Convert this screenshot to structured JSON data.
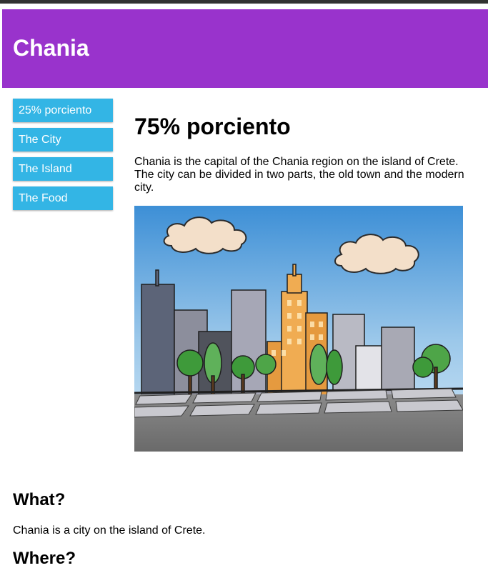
{
  "header": {
    "title": "Chania"
  },
  "menu": {
    "items": [
      {
        "label": "25% porciento"
      },
      {
        "label": "The City"
      },
      {
        "label": "The Island"
      },
      {
        "label": "The Food"
      }
    ]
  },
  "main": {
    "heading": "75% porciento",
    "paragraph": "Chania is the capital of the Chania region on the island of Crete. The city can be divided in two parts, the old town and the modern city."
  },
  "sections": [
    {
      "heading": "What?",
      "text": "Chania is a city on the island of Crete."
    },
    {
      "heading": "Where?"
    }
  ],
  "colors": {
    "header_bg": "#9933cc",
    "menu_bg": "#33b5e5",
    "menu_text": "#ffffff",
    "topbar": "#323232"
  }
}
